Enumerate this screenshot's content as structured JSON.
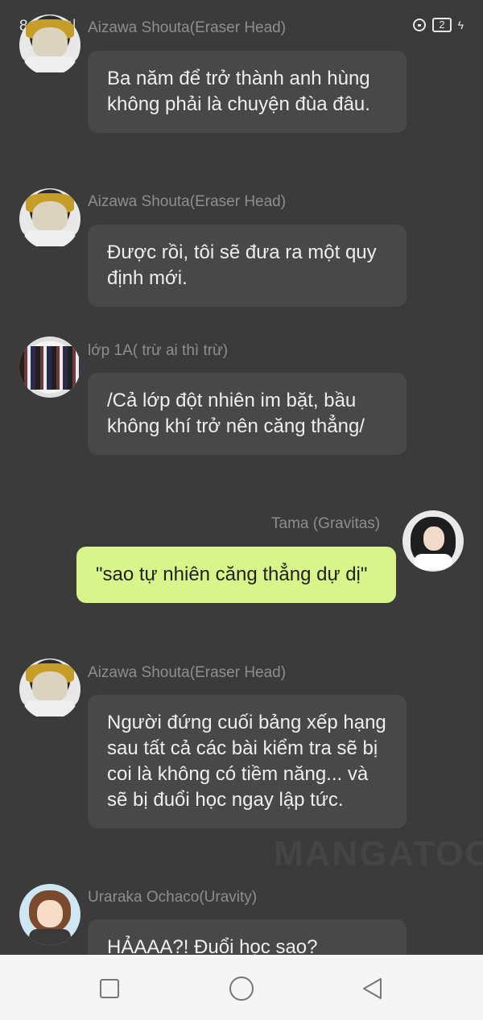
{
  "status_bar": {
    "time": "8:41",
    "signal": "..ıl",
    "battery": "2"
  },
  "messages": [
    {
      "name": "Aizawa Shouta(Eraser Head)",
      "text": "Ba năm để trở thành anh hùng không phải là chuyện đùa đâu.",
      "side": "left",
      "avatar": "aizawa-avatar"
    },
    {
      "name": "Aizawa Shouta(Eraser Head)",
      "text": "Được rồi, tôi sẽ đưa ra một quy định mới.",
      "side": "left",
      "avatar": "aizawa-avatar"
    },
    {
      "name": "lớp 1A( trừ ai thì trừ)",
      "text": "/Cả lớp đột nhiên im bặt, bầu không khí trở nên căng thẳng/",
      "side": "left",
      "avatar": "class-1a-avatar"
    },
    {
      "name": "Tama (Gravitas)",
      "text": "\"sao tự nhiên căng thẳng dự dị\"",
      "side": "right",
      "avatar": "tama-avatar"
    },
    {
      "name": "Aizawa Shouta(Eraser Head)",
      "text": "Người đứng cuối bảng xếp hạng sau tất cả các bài kiểm tra sẽ bị coi là không có tiềm năng... và sẽ bị đuổi học ngay lập tức.",
      "side": "left",
      "avatar": "aizawa-avatar"
    },
    {
      "name": "Uraraka Ochaco(Uravity)",
      "text": "HẢAAA?! Đuổi học sao?",
      "side": "left",
      "avatar": "uraraka-avatar"
    }
  ],
  "watermark": "MANGATOON",
  "colors": {
    "background": "#3b3b3b",
    "bubble_left": "#484848",
    "bubble_right": "#d7f58a",
    "name_text": "#8e8e8e"
  }
}
